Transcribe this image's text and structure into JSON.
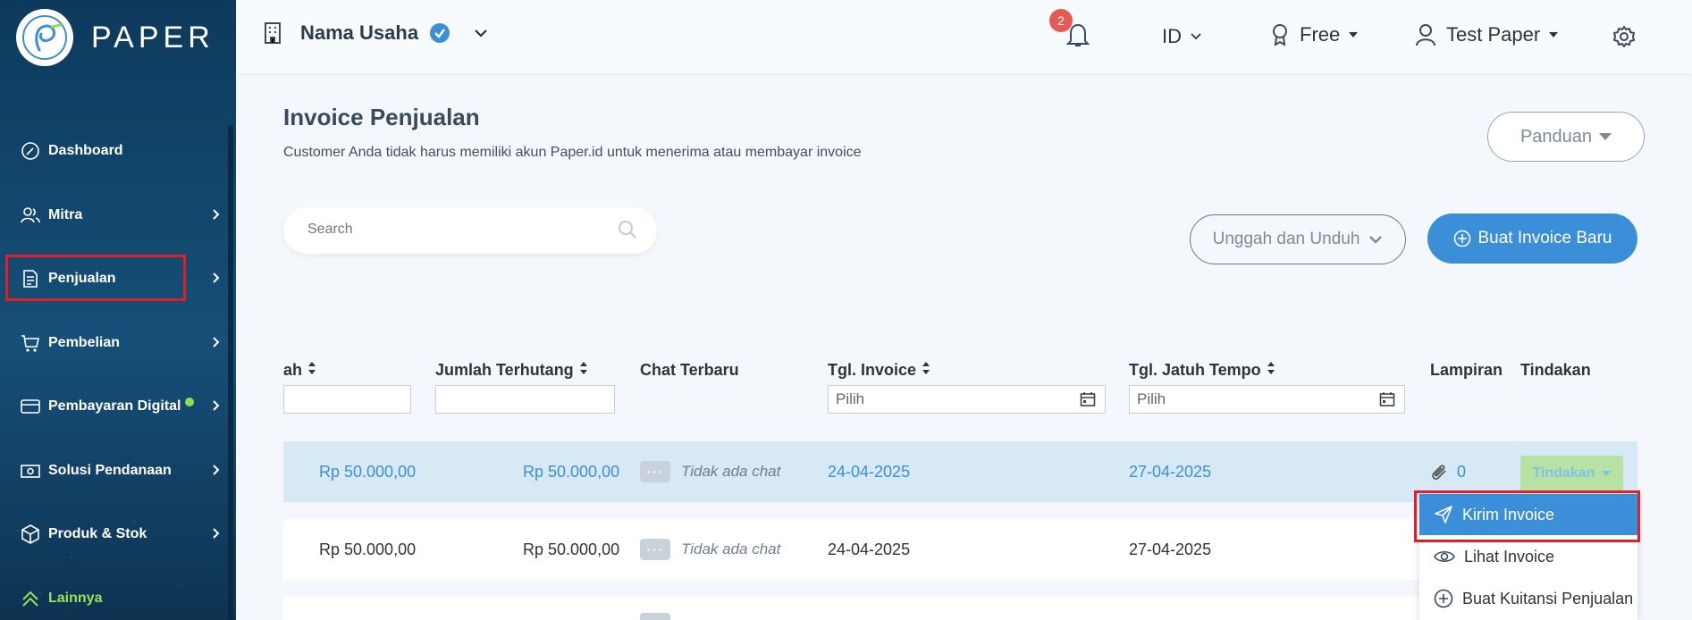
{
  "app": {
    "logo_text": "PAPER"
  },
  "sidebar": {
    "items": [
      {
        "label": "Dashboard",
        "icon": "dashboard-icon"
      },
      {
        "label": "Mitra",
        "icon": "users-icon"
      },
      {
        "label": "Penjualan",
        "icon": "document-icon"
      },
      {
        "label": "Pembelian",
        "icon": "cart-icon"
      },
      {
        "label": "Pembayaran Digital",
        "icon": "card-icon"
      },
      {
        "label": "Solusi Pendanaan",
        "icon": "money-icon"
      },
      {
        "label": "Produk & Stok",
        "icon": "box-icon"
      },
      {
        "label": "Lainnya",
        "icon": "chevrons-up-icon"
      }
    ]
  },
  "topbar": {
    "business_name": "Nama Usaha",
    "notification_count": "2",
    "language": "ID",
    "plan": "Free",
    "user": "Test Paper"
  },
  "page": {
    "title": "Invoice Penjualan",
    "subtitle": "Customer Anda tidak harus memiliki akun Paper.id untuk menerima atau membayar invoice",
    "panduan_label": "Panduan",
    "search_placeholder": "Search",
    "unggah_label": "Unggah dan Unduh",
    "buat_label": "Buat Invoice Baru"
  },
  "table": {
    "headers": {
      "jumlah": "ah",
      "terhutang": "Jumlah Terhutang",
      "chat": "Chat Terbaru",
      "tgl_invoice": "Tgl. Invoice",
      "tgl_jatuh": "Tgl. Jatuh Tempo",
      "lampiran": "Lampiran",
      "tindakan": "Tindakan"
    },
    "date_placeholder": "Pilih",
    "rows": [
      {
        "jumlah": "Rp 50.000,00",
        "terhutang": "Rp 50.000,00",
        "chat": "Tidak ada chat",
        "tgl_invoice": "24-04-2025",
        "tgl_jatuh": "27-04-2025",
        "lampiran": "0",
        "tindakan": "Tindakan"
      },
      {
        "jumlah": "Rp 50.000,00",
        "terhutang": "Rp 50.000,00",
        "chat": "Tidak ada chat",
        "tgl_invoice": "24-04-2025",
        "tgl_jatuh": "27-04-2025"
      }
    ]
  },
  "dropdown": {
    "items": [
      "Kirim Invoice",
      "Lihat Invoice",
      "Buat Kuitansi Penjualan"
    ]
  },
  "colors": {
    "primary": "#3a8fd8",
    "sidebar": "#164f78",
    "highlight": "#e01e28",
    "badge": "#e65a55"
  }
}
